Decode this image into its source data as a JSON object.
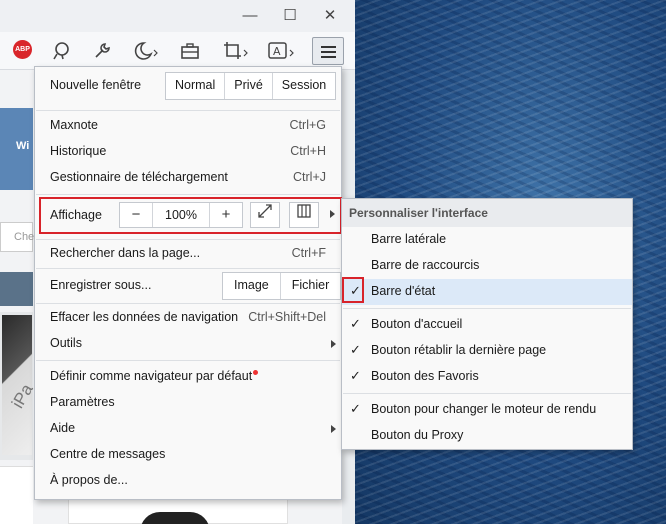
{
  "colors": {
    "accent_red": "#d8232a",
    "highlight": "#dce9f8"
  },
  "window_controls": {
    "minimize": "—",
    "maximize": "☐",
    "close": "✕"
  },
  "toolbar": {
    "abp": "ABP"
  },
  "page_bg": {
    "banner_text": "Wi",
    "search_placeholder": "Che",
    "device_text": "iPa"
  },
  "menu": {
    "new_window": {
      "label": "Nouvelle fenêtre",
      "modes": [
        "Normal",
        "Privé",
        "Session"
      ]
    },
    "maxnote": {
      "label": "Maxnote",
      "shortcut": "Ctrl+G"
    },
    "history": {
      "label": "Historique",
      "shortcut": "Ctrl+H"
    },
    "downloads": {
      "label": "Gestionnaire de téléchargement",
      "shortcut": "Ctrl+J"
    },
    "view": {
      "label": "Affichage",
      "zoom_out": "−",
      "zoom_value": "100%",
      "zoom_in": "+"
    },
    "find": {
      "label": "Rechercher dans la page...",
      "shortcut": "Ctrl+F"
    },
    "save_as": {
      "label": "Enregistrer sous...",
      "options": [
        "Image",
        "Fichier"
      ]
    },
    "clear_data": {
      "label": "Effacer les données de navigation",
      "shortcut": "Ctrl+Shift+Del"
    },
    "tools": {
      "label": "Outils"
    },
    "default_browser": {
      "label": "Définir comme navigateur par défaut"
    },
    "settings": {
      "label": "Paramètres"
    },
    "help": {
      "label": "Aide"
    },
    "messages": {
      "label": "Centre de messages"
    },
    "about": {
      "label": "À propos de..."
    }
  },
  "submenu": {
    "header": "Personnaliser l'interface",
    "items": [
      {
        "label": "Barre latérale",
        "checked": false
      },
      {
        "label": "Barre de raccourcis",
        "checked": false
      },
      {
        "label": "Barre d'état",
        "checked": true
      },
      {
        "label": "Bouton d'accueil",
        "checked": true
      },
      {
        "label": "Bouton rétablir la dernière page",
        "checked": true
      },
      {
        "label": "Bouton des Favoris",
        "checked": true
      },
      {
        "label": "Bouton pour changer le moteur de rendu",
        "checked": true
      },
      {
        "label": "Bouton du Proxy",
        "checked": false
      }
    ],
    "check_glyph": "✓"
  }
}
